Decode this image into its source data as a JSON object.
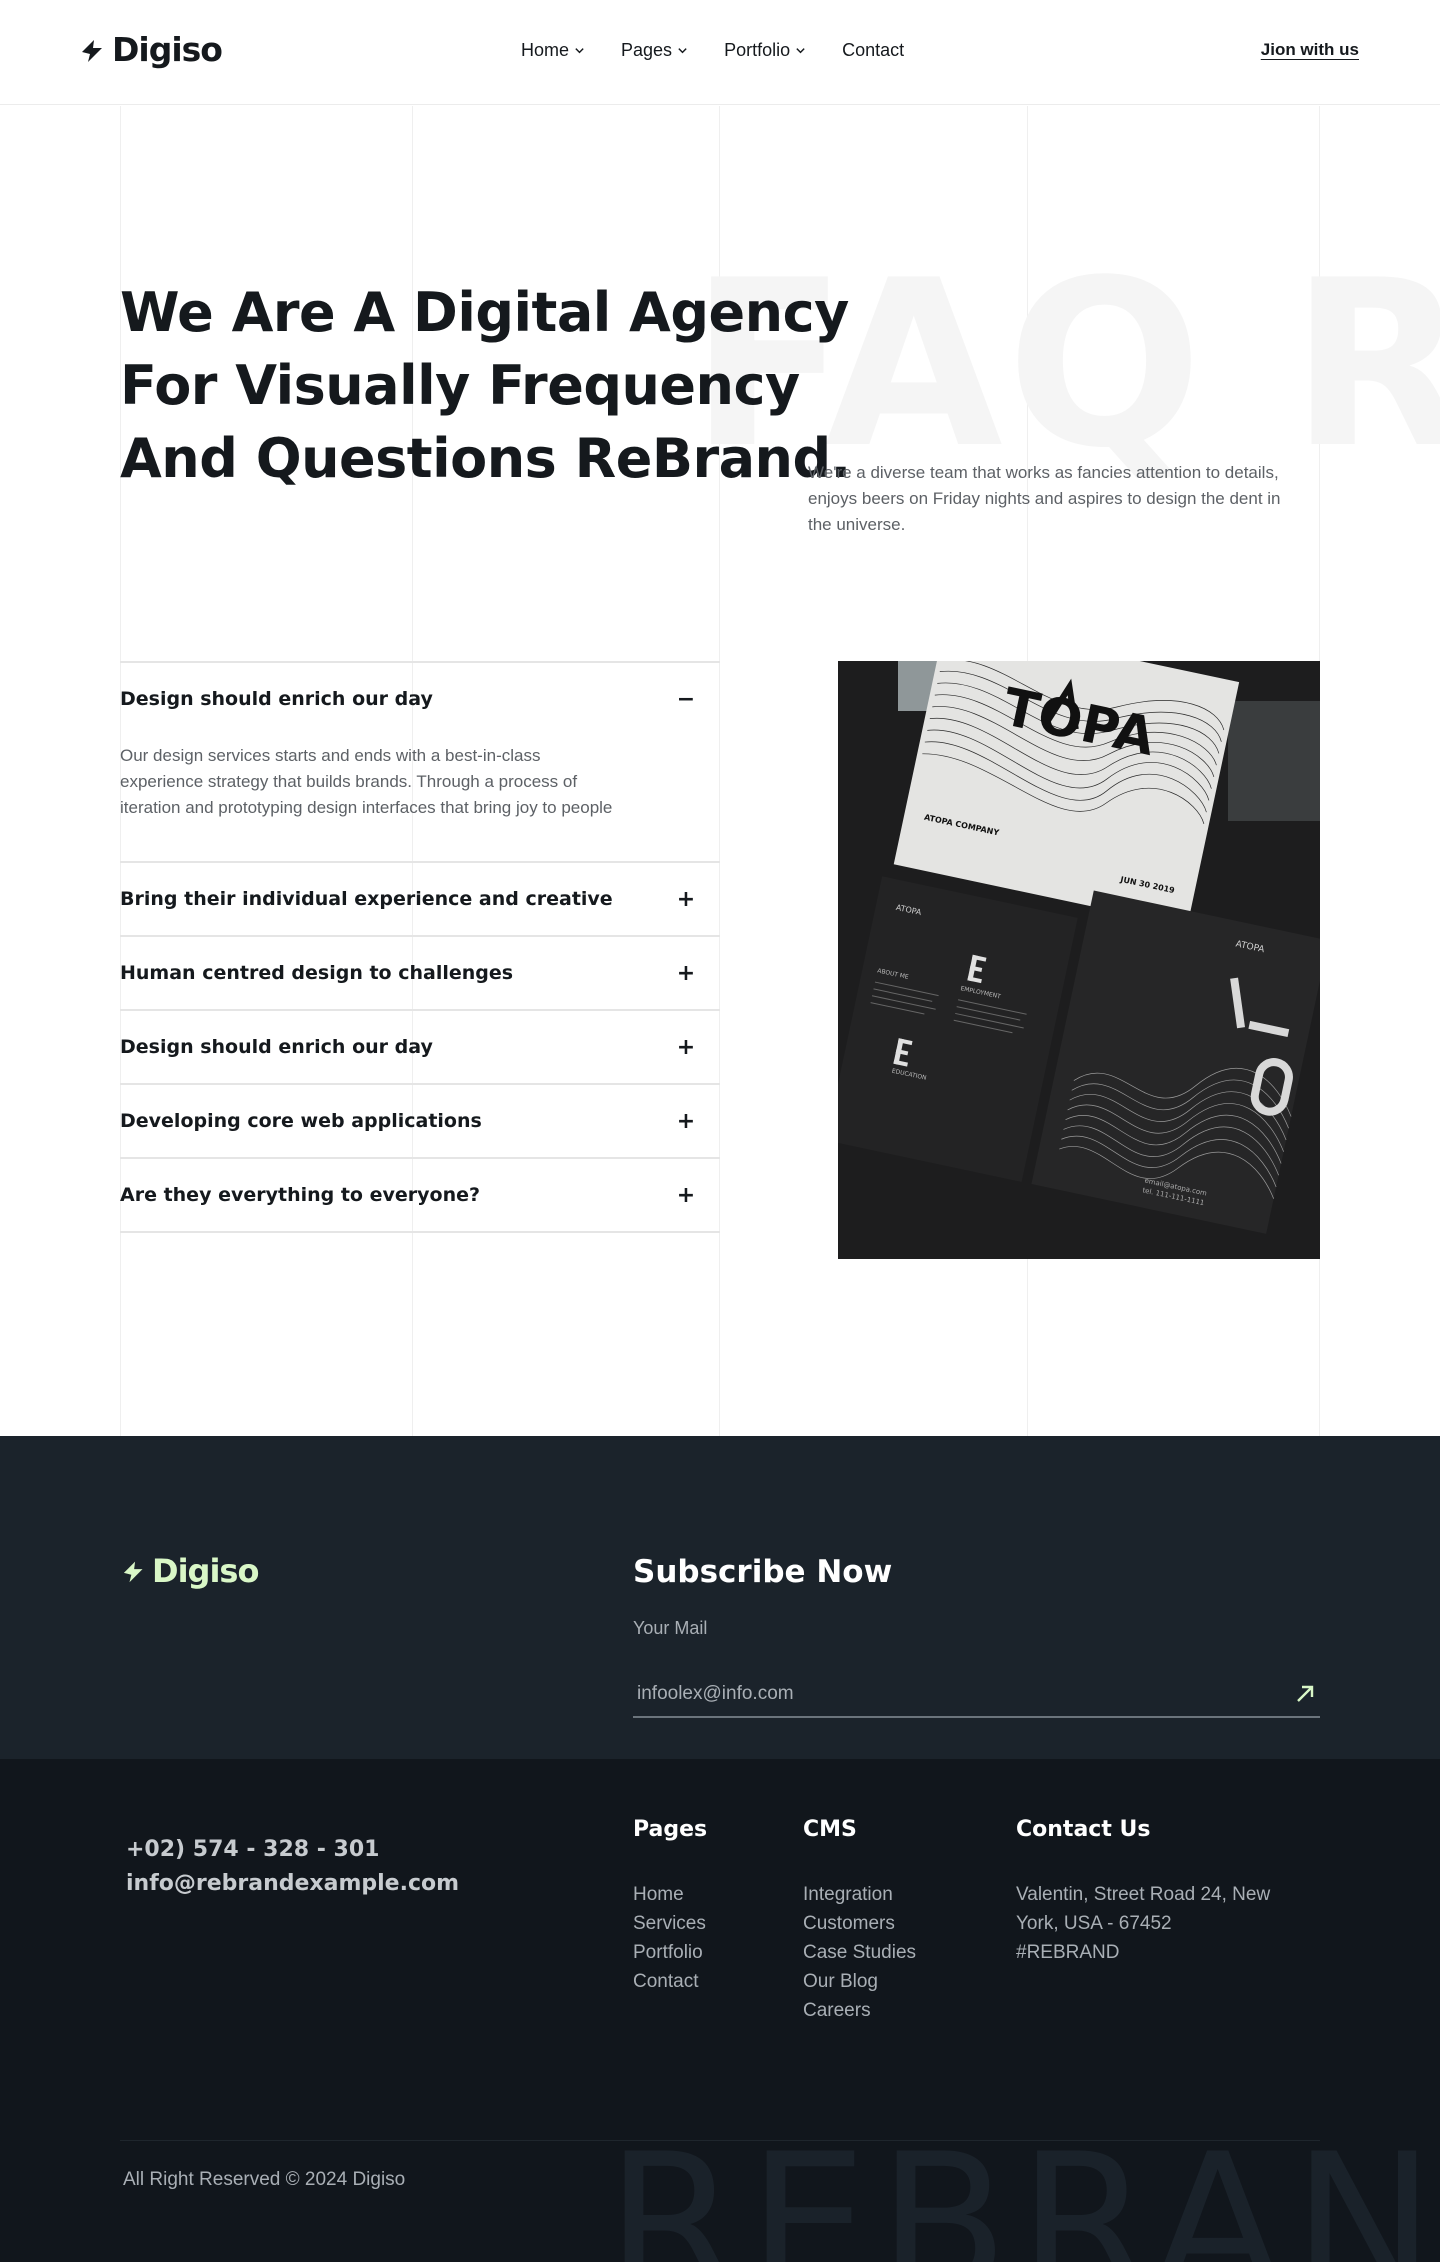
{
  "header": {
    "logo": "Digiso",
    "nav": [
      {
        "label": "Home",
        "has_dropdown": true
      },
      {
        "label": "Pages",
        "has_dropdown": true
      },
      {
        "label": "Portfolio",
        "has_dropdown": true
      },
      {
        "label": "Contact",
        "has_dropdown": false
      }
    ],
    "cta": "Jion with us"
  },
  "hero": {
    "bg_word": "FAQ REBRAND",
    "title": "We Are A Digital Agency For Visually Frequency And Questions ReBrand.",
    "description": "We're a diverse team that works as fancies attention to details, enjoys beers on Friday nights and aspires to design the dent in the universe."
  },
  "faq": {
    "items": [
      {
        "question": "Design should enrich our day",
        "open": true,
        "toggle": "−",
        "answer": "Our design services starts and ends with a best-in-class experience strategy that builds brands. Through a process of iteration and prototyping design interfaces that bring joy to people"
      },
      {
        "question": "Bring their individual experience and creative",
        "open": false,
        "toggle": "+"
      },
      {
        "question": "Human centred design to challenges",
        "open": false,
        "toggle": "+"
      },
      {
        "question": "Design should enrich our day",
        "open": false,
        "toggle": "+"
      },
      {
        "question": "Developing core web applications",
        "open": false,
        "toggle": "+"
      },
      {
        "question": "Are they everything to everyone?",
        "open": false,
        "toggle": "+"
      }
    ]
  },
  "visual": {
    "brand": "TOPA",
    "company": "ATOPA COMPANY",
    "date": "JUN 30 2019",
    "card_brand": "ATOPA",
    "labels": [
      "ABOUT ME",
      "EMPLOYMENT",
      "EDUCATION"
    ],
    "contact": "email@atopa.com",
    "phone": "tel. 111-111-1111"
  },
  "subscribe": {
    "logo": "Digiso",
    "title": "Subscribe Now",
    "label": "Your Mail",
    "placeholder": "infoolex@info.com"
  },
  "footer": {
    "phone": "+02) 574 - 328 - 301",
    "email": "info@rebrandexample.com",
    "columns": {
      "pages": {
        "title": "Pages",
        "links": [
          "Home",
          "Services",
          "Portfolio",
          "Contact"
        ]
      },
      "cms": {
        "title": "CMS",
        "links": [
          "Integration",
          "Customers",
          "Case Studies",
          "Our Blog",
          "Careers"
        ]
      },
      "contact": {
        "title": "Contact Us",
        "address": "Valentin, Street Road 24, New York, USA - 67452",
        "tag": "#REBRAND"
      }
    },
    "copyright": "All Right Reserved © 2024 Digiso",
    "bg_word": "REBRAND"
  },
  "colors": {
    "text_dark": "#15191d",
    "footer_top_bg": "#1b232b",
    "footer_bottom_bg": "#11161c",
    "accent_green": "#d9f7c7",
    "muted": "#5d6166"
  }
}
